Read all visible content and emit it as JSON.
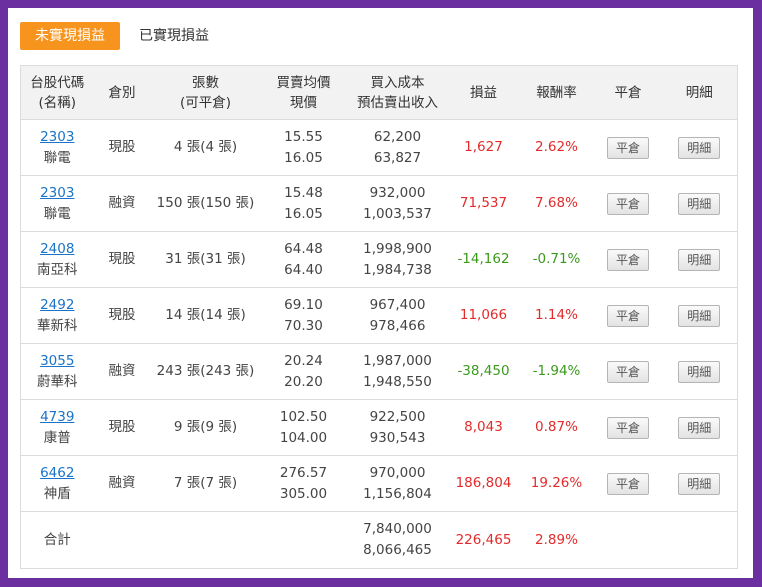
{
  "tabs": {
    "unrealized": "未實現損益",
    "realized": "已實現損益"
  },
  "headers": {
    "code_1": "台股代碼",
    "code_2": "(名稱)",
    "category": "倉別",
    "shares_1": "張數",
    "shares_2": "(可平倉)",
    "price_1": "買賣均價",
    "price_2": "現價",
    "cost_1": "買入成本",
    "cost_2": "預估賣出收入",
    "pnl": "損益",
    "rate": "報酬率",
    "close": "平倉",
    "detail": "明細"
  },
  "rows": [
    {
      "code": "2303",
      "name": "聯電",
      "category": "現股",
      "shares": "4 張(4 張)",
      "avg_price": "15.55",
      "cur_price": "16.05",
      "cost": "62,200",
      "revenue": "63,827",
      "pnl": "1,627",
      "rate": "2.62%",
      "trend": "pos",
      "close_label": "平倉",
      "detail_label": "明細"
    },
    {
      "code": "2303",
      "name": "聯電",
      "category": "融資",
      "shares": "150 張(150 張)",
      "avg_price": "15.48",
      "cur_price": "16.05",
      "cost": "932,000",
      "revenue": "1,003,537",
      "pnl": "71,537",
      "rate": "7.68%",
      "trend": "pos",
      "close_label": "平倉",
      "detail_label": "明細"
    },
    {
      "code": "2408",
      "name": "南亞科",
      "category": "現股",
      "shares": "31 張(31 張)",
      "avg_price": "64.48",
      "cur_price": "64.40",
      "cost": "1,998,900",
      "revenue": "1,984,738",
      "pnl": "-14,162",
      "rate": "-0.71%",
      "trend": "neg",
      "close_label": "平倉",
      "detail_label": "明細"
    },
    {
      "code": "2492",
      "name": "華新科",
      "category": "現股",
      "shares": "14 張(14 張)",
      "avg_price": "69.10",
      "cur_price": "70.30",
      "cost": "967,400",
      "revenue": "978,466",
      "pnl": "11,066",
      "rate": "1.14%",
      "trend": "pos",
      "close_label": "平倉",
      "detail_label": "明細"
    },
    {
      "code": "3055",
      "name": "蔚華科",
      "category": "融資",
      "shares": "243 張(243 張)",
      "avg_price": "20.24",
      "cur_price": "20.20",
      "cost": "1,987,000",
      "revenue": "1,948,550",
      "pnl": "-38,450",
      "rate": "-1.94%",
      "trend": "neg",
      "close_label": "平倉",
      "detail_label": "明細"
    },
    {
      "code": "4739",
      "name": "康普",
      "category": "現股",
      "shares": "9 張(9 張)",
      "avg_price": "102.50",
      "cur_price": "104.00",
      "cost": "922,500",
      "revenue": "930,543",
      "pnl": "8,043",
      "rate": "0.87%",
      "trend": "pos",
      "close_label": "平倉",
      "detail_label": "明細"
    },
    {
      "code": "6462",
      "name": "神盾",
      "category": "融資",
      "shares": "7 張(7 張)",
      "avg_price": "276.57",
      "cur_price": "305.00",
      "cost": "970,000",
      "revenue": "1,156,804",
      "pnl": "186,804",
      "rate": "19.26%",
      "trend": "pos",
      "close_label": "平倉",
      "detail_label": "明細"
    }
  ],
  "total": {
    "label": "合計",
    "cost": "7,840,000",
    "revenue": "8,066,465",
    "pnl": "226,465",
    "rate": "2.89%"
  },
  "colors": {
    "accent": "#f7941d",
    "positive": "#e32b2b",
    "negative": "#3a9a1c",
    "link": "#1a73c8",
    "frame": "#6b2fa0"
  }
}
